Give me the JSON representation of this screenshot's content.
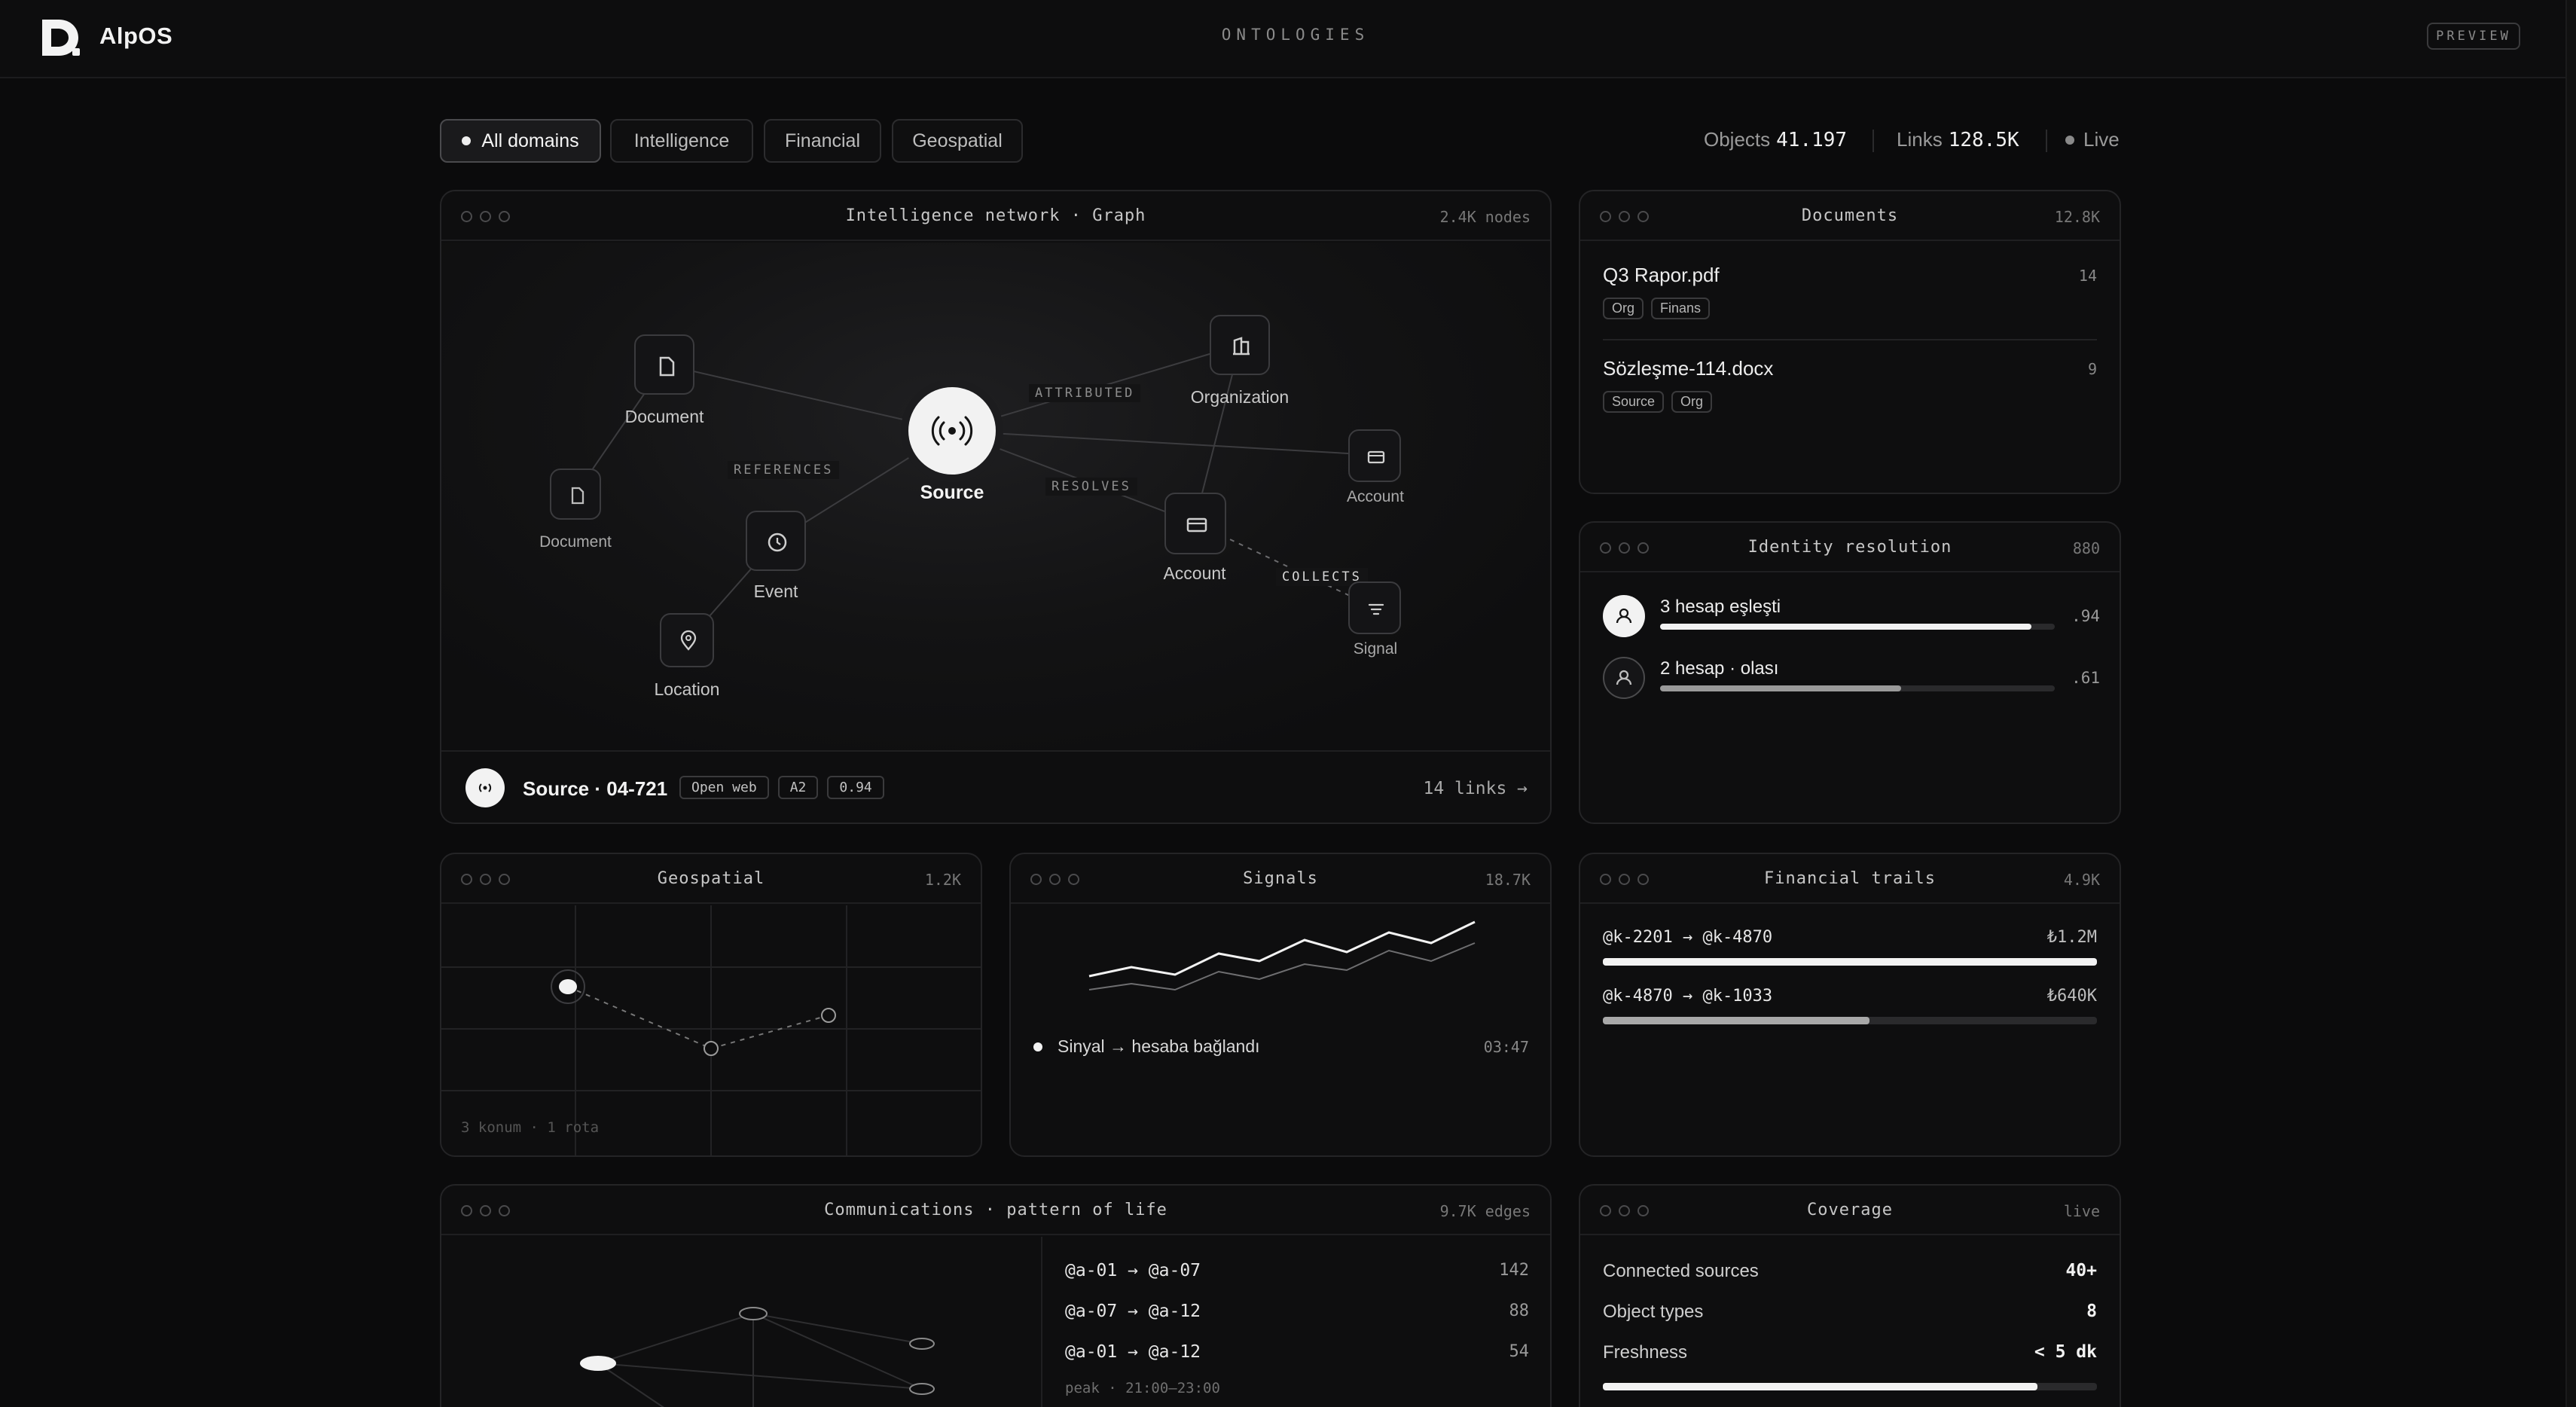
{
  "header": {
    "brand": "AlpOS",
    "nav_title": "ONTOLOGIES",
    "badge": "PREVIEW"
  },
  "filters": {
    "items": [
      {
        "label": "All domains",
        "active": true
      },
      {
        "label": "Intelligence",
        "active": false
      },
      {
        "label": "Financial",
        "active": false
      },
      {
        "label": "Geospatial",
        "active": false
      }
    ]
  },
  "stats": {
    "objects_label": "Objects",
    "objects_value": "41.197",
    "links_label": "Links",
    "links_value": "128.5K",
    "live_label": "Live"
  },
  "graph_panel": {
    "title": "Intelligence network · Graph",
    "count": "2.4K nodes",
    "nodes": {
      "document_a": "Document",
      "document_b": "Document",
      "source": "Source",
      "organization": "Organization",
      "account_a": "Account",
      "account_b": "Account",
      "event": "Event",
      "location": "Location",
      "signal": "Signal"
    },
    "edges": {
      "attributed": "ATTRIBUTED",
      "references": "REFERENCES",
      "resolves": "RESOLVES",
      "collects": "COLLECTS"
    },
    "footer": {
      "title": "Source · 04-721",
      "tags": [
        "Open web",
        "A2",
        "0.94"
      ],
      "links": "14 links →"
    }
  },
  "documents_panel": {
    "title": "Documents",
    "count": "12.8K",
    "items": [
      {
        "name": "Q3 Rapor.pdf",
        "count": "14",
        "tags": [
          "Org",
          "Finans"
        ]
      },
      {
        "name": "Sözleşme-114.docx",
        "count": "9",
        "tags": [
          "Source",
          "Org"
        ]
      }
    ]
  },
  "identity_panel": {
    "title": "Identity resolution",
    "count": "880",
    "items": [
      {
        "label": "3 hesap eşleşti",
        "score": ".94",
        "fill": 0.94
      },
      {
        "label": "2 hesap · olası",
        "score": ".61",
        "fill": 0.61
      }
    ]
  },
  "geo_panel": {
    "title": "Geospatial",
    "count": "1.2K",
    "footer": "3 konum · 1 rota"
  },
  "signals_panel": {
    "title": "Signals",
    "count": "18.7K",
    "event": "Sinyal → hesaba bağlandı",
    "time": "03:47"
  },
  "financial_panel": {
    "title": "Financial trails",
    "count": "4.9K",
    "items": [
      {
        "route": "@k-2201 → @k-4870",
        "amount": "₺1.2M",
        "fill": 1.0
      },
      {
        "route": "@k-4870 → @k-1033",
        "amount": "₺640K",
        "fill": 0.54
      }
    ]
  },
  "comms_panel": {
    "title": "Communications · pattern of life",
    "count": "9.7K edges",
    "rows": [
      {
        "pair": "@a-01 → @a-07",
        "count": "142"
      },
      {
        "pair": "@a-07 → @a-12",
        "count": "88"
      },
      {
        "pair": "@a-01 → @a-12",
        "count": "54"
      }
    ],
    "footer": "peak · 21:00–23:00"
  },
  "coverage_panel": {
    "title": "Coverage",
    "count": "live",
    "rows": [
      {
        "label": "Connected sources",
        "value": "40+"
      },
      {
        "label": "Object types",
        "value": "8"
      },
      {
        "label": "Freshness",
        "value": "< 5 dk"
      }
    ],
    "freshness_fill": 0.88
  }
}
